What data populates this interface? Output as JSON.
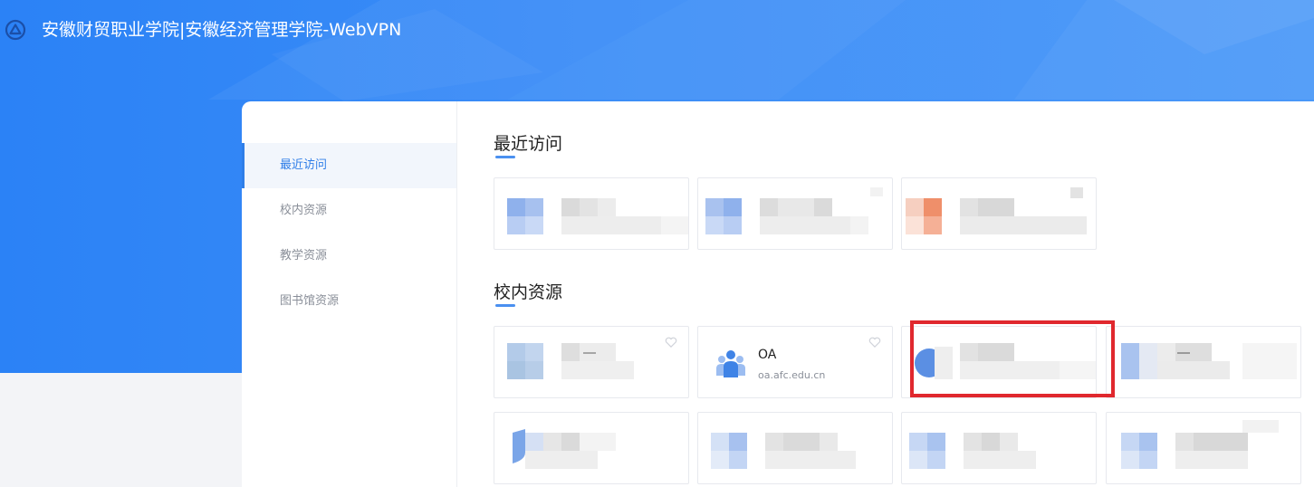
{
  "header": {
    "title": "安徽财贸职业学院|安徽经济管理学院-WebVPN",
    "logo_icon": "webvpn-logo-icon"
  },
  "sidebar": {
    "items": [
      {
        "label": "最近访问",
        "active": true
      },
      {
        "label": "校内资源",
        "active": false
      },
      {
        "label": "教学资源",
        "active": false
      },
      {
        "label": "图书馆资源",
        "active": false
      }
    ]
  },
  "sections": {
    "recent": {
      "title": "最近访问"
    },
    "campus": {
      "title": "校内资源"
    }
  },
  "highlighted_card": {
    "name": "OA",
    "url": "oa.afc.edu.cn",
    "icon": "users-icon",
    "fav_icon": "heart-icon"
  },
  "colors": {
    "brand_blue": "#2b82f6",
    "accent": "#2f7ee8",
    "highlight_border": "#e0282e"
  }
}
